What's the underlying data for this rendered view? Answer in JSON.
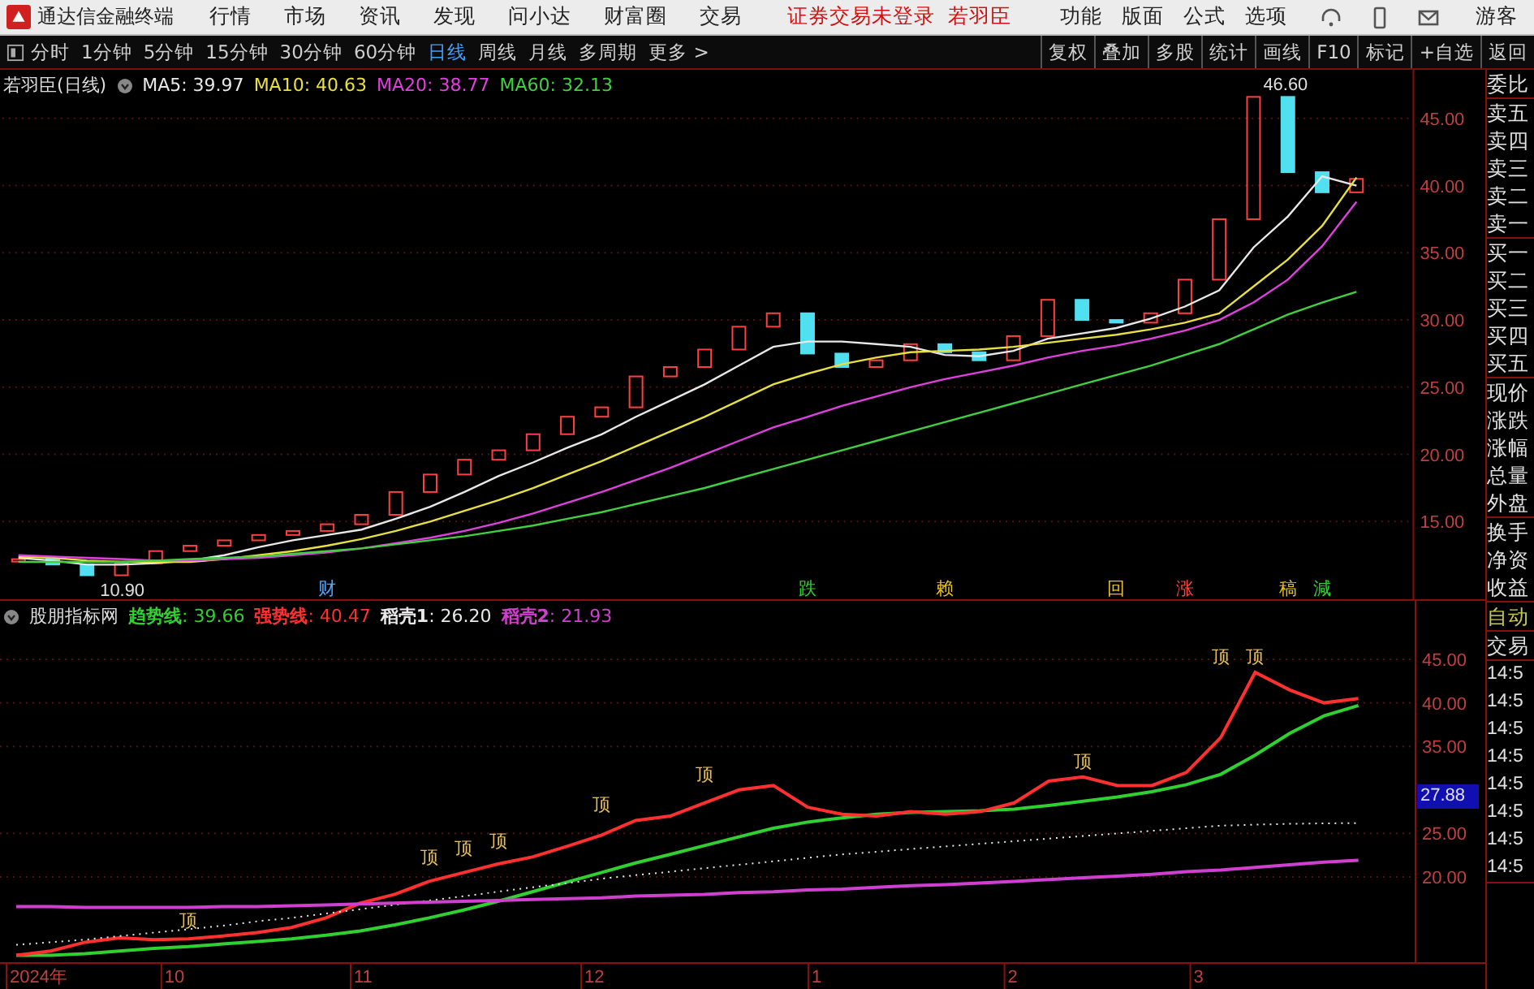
{
  "title_bar": {
    "app_name": "通达信金融终端",
    "menus": [
      "行情",
      "市场",
      "资讯",
      "发现",
      "问小达",
      "财富圈",
      "交易"
    ],
    "login_status": "证券交易未登录",
    "stock_name": "若羽臣",
    "right_menus": [
      "功能",
      "版面",
      "公式",
      "选项"
    ],
    "user": "游客"
  },
  "toolbar": {
    "periods": [
      {
        "label": "分时",
        "selected": false
      },
      {
        "label": "1分钟",
        "selected": false
      },
      {
        "label": "5分钟",
        "selected": false
      },
      {
        "label": "15分钟",
        "selected": false
      },
      {
        "label": "30分钟",
        "selected": false
      },
      {
        "label": "60分钟",
        "selected": false
      },
      {
        "label": "日线",
        "selected": true
      },
      {
        "label": "周线",
        "selected": false
      },
      {
        "label": "月线",
        "selected": false
      },
      {
        "label": "多周期",
        "selected": false
      },
      {
        "label": "更多 >",
        "selected": false
      }
    ],
    "actions": [
      "复权",
      "叠加",
      "多股",
      "统计",
      "画线",
      "F10",
      "标记",
      "+自选",
      "返回"
    ]
  },
  "main_chart": {
    "legend_title": "若羽臣(日线)",
    "legend": [
      {
        "label": "MA5: 39.97",
        "color": "#e8e8e8"
      },
      {
        "label": "MA10: 40.63",
        "color": "#e8e040"
      },
      {
        "label": "MA20: 38.77",
        "color": "#e040e0"
      },
      {
        "label": "MA60: 32.13",
        "color": "#40d040"
      }
    ],
    "y_axis_labels": [
      "45.00",
      "40.00",
      "35.00",
      "30.00",
      "25.00",
      "20.00",
      "15.00"
    ],
    "high_label": "46.60",
    "low_label": "10.90",
    "markers": [
      {
        "text": "财",
        "color": "#4aa8ff"
      },
      {
        "text": "跌",
        "color": "#30d030"
      },
      {
        "text": "赖",
        "color": "#e8c020"
      },
      {
        "text": "回",
        "color": "#e8c020"
      },
      {
        "text": "涨",
        "color": "#ff4040"
      },
      {
        "text": "稿",
        "color": "#e8c020"
      },
      {
        "text": "減",
        "color": "#30d030"
      }
    ]
  },
  "indicator_chart": {
    "legend_title": "股朋指标网",
    "legend": [
      {
        "name": "趋势线",
        "value": ": 39.66",
        "color": "#30d030"
      },
      {
        "name": "强势线",
        "value": ": 40.47",
        "color": "#ff3030"
      },
      {
        "name": "稻壳1",
        "value": ": 26.20",
        "color": "#e8e8e8"
      },
      {
        "name": "稻壳2",
        "value": ": 21.93",
        "color": "#d040d0"
      }
    ],
    "y_axis_labels": [
      "45.00",
      "40.00",
      "35.00",
      "25.00",
      "20.00"
    ],
    "current_value": "27.88",
    "peak_labels": [
      "顶",
      "顶",
      "顶",
      "顶",
      "顶",
      "顶",
      "顶",
      "顶",
      "顶"
    ]
  },
  "date_axis": [
    "2024年",
    "10",
    "11",
    "12",
    "1",
    "2",
    "3"
  ],
  "quote_panel": {
    "groups": [
      {
        "kind": "label",
        "items": [
          "委比"
        ]
      },
      {
        "kind": "label",
        "items": [
          "卖五",
          "卖四",
          "卖三",
          "卖二",
          "卖一"
        ]
      },
      {
        "kind": "label",
        "items": [
          "买一",
          "买二",
          "买三",
          "买四",
          "买五"
        ]
      },
      {
        "kind": "label",
        "items": [
          "现价",
          "涨跌",
          "涨幅",
          "总量",
          "外盘"
        ]
      },
      {
        "kind": "label",
        "items": [
          "换手",
          "净资",
          "收益"
        ]
      },
      {
        "kind": "action",
        "items": [
          "自动"
        ]
      },
      {
        "kind": "label",
        "items": [
          "交易"
        ]
      },
      {
        "kind": "time",
        "items": [
          "14:5",
          "14:5",
          "14:5",
          "14:5",
          "14:5",
          "14:5",
          "14:5",
          "14:5"
        ]
      }
    ]
  }
}
